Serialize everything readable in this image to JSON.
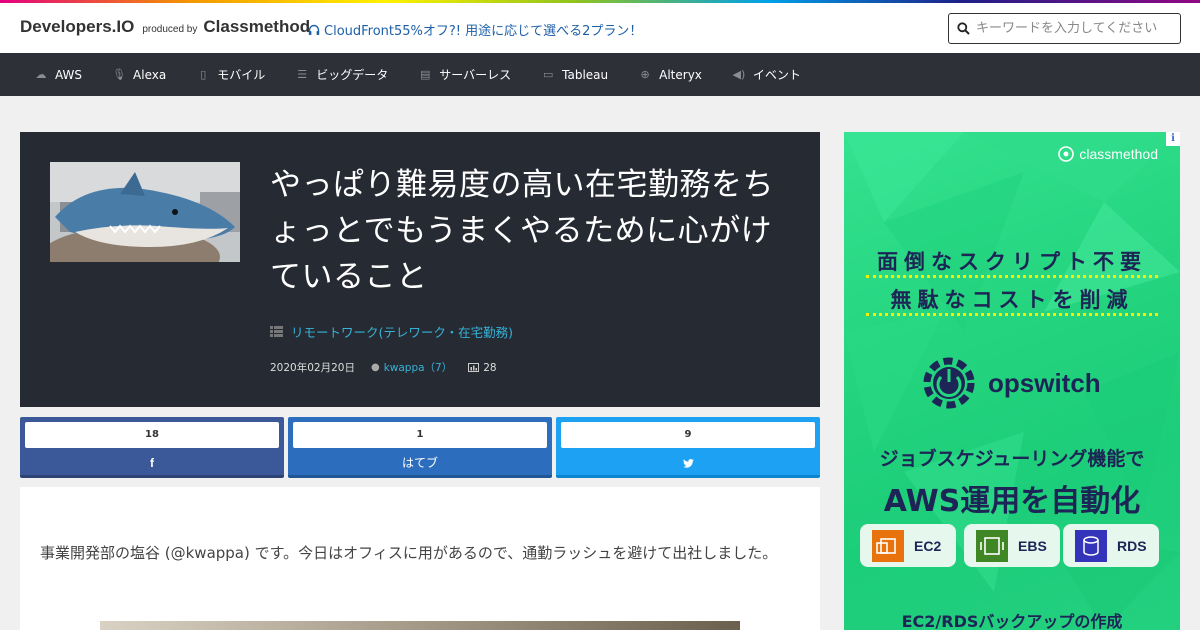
{
  "header": {
    "brand_main": "Developers.IO",
    "brand_sub": "produced by",
    "brand_company": "Classmethod",
    "promo_text": "CloudFront55%オフ?! 用途に応じて選べる2プラン！",
    "search_placeholder": "キーワードを入力してください"
  },
  "nav": {
    "items": [
      {
        "label": "AWS",
        "icon": "cloud-icon"
      },
      {
        "label": "Alexa",
        "icon": "microphone-icon"
      },
      {
        "label": "モバイル",
        "icon": "mobile-icon"
      },
      {
        "label": "ビッグデータ",
        "icon": "list-icon"
      },
      {
        "label": "サーバーレス",
        "icon": "server-icon"
      },
      {
        "label": "Tableau",
        "icon": "monitor-icon"
      },
      {
        "label": "Alteryx",
        "icon": "circle-arrow-icon"
      },
      {
        "label": "イベント",
        "icon": "speaker-icon"
      }
    ]
  },
  "article": {
    "title": "やっぱり難易度の高い在宅勤務をちょっとでもうまくやるために心がけていること",
    "category": "リモートワーク(テレワーク・在宅勤務)",
    "date": "2020年02月20日",
    "author": "kwappa（7）",
    "views": "28",
    "body_text": "事業開発部の塩谷 (@kwappa) です。今日はオフィスに用があるので、通勤ラッシュを避けて出社しました。"
  },
  "share": {
    "facebook": {
      "count": "18",
      "label": "f"
    },
    "hatena": {
      "count": "1",
      "label": "はてブ"
    },
    "twitter": {
      "count": "9",
      "label": ""
    }
  },
  "ad": {
    "info": "i",
    "logo": "classmethod",
    "headline1": "面倒なスクリプト不要",
    "headline2": "無駄なコストを削減",
    "product": "opswitch",
    "subline": "ジョブスケジューリング機能で",
    "bigline": "AWS運用を自動化",
    "chips": [
      "EC2",
      "EBS",
      "RDS"
    ],
    "footer": "EC2/RDSバックアップの作成"
  },
  "colors": {
    "nav_bg": "#2e3038",
    "hero_bg": "#262a33",
    "accent_link": "#37b2d8",
    "facebook": "#3b5998",
    "hatena": "#2c6ebd",
    "twitter": "#1da1f2",
    "ad_green": "#24d47e",
    "ad_navy": "#1d2556"
  }
}
